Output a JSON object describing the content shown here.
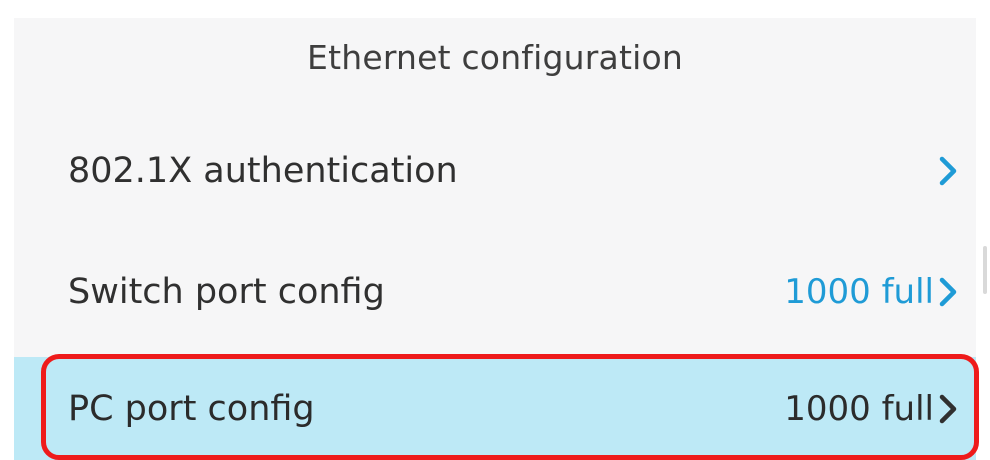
{
  "screen": {
    "title": "Ethernet configuration"
  },
  "menu": {
    "items": [
      {
        "label": "802.1X authentication",
        "value": "",
        "icon": "chevron-right-icon"
      },
      {
        "label": "Switch port config",
        "value": "1000 full",
        "icon": "chevron-right-icon"
      },
      {
        "label": "PC port config",
        "value": "1000 full",
        "icon": "chevron-right-icon"
      }
    ]
  },
  "colors": {
    "accent": "#1f9bd6",
    "selected_row": "#bde9f6",
    "highlight_border": "#ee1b1b",
    "panel_bg": "#f6f6f7"
  }
}
